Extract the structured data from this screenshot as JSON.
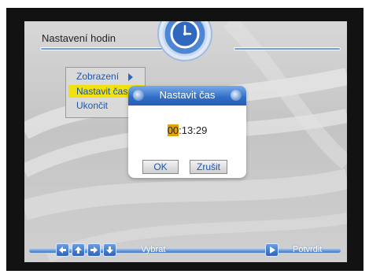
{
  "header": {
    "title": "Nastavení hodin"
  },
  "menu": {
    "items": [
      {
        "label": "Zobrazení",
        "has_submenu": true,
        "selected": false
      },
      {
        "label": "Nastavit čas",
        "has_submenu": false,
        "selected": true
      },
      {
        "label": "Ukončit",
        "has_submenu": false,
        "selected": false
      }
    ]
  },
  "dialog": {
    "title": "Nastavit čas",
    "time_hours": "00",
    "time_rest": ":13:29",
    "ok_label": "OK",
    "cancel_label": "Zrušit"
  },
  "footer": {
    "nav_keys": [
      "left-arrow-icon",
      "up-arrow-icon",
      "right-arrow-icon",
      "down-arrow-icon"
    ],
    "select_label": "Vybrat",
    "confirm_icon": "play-icon",
    "confirm_label": "Potvrdit"
  },
  "colors": {
    "accent_blue": "#2f6dc5",
    "highlight_yellow": "#f0e210",
    "time_highlight": "#e0a400"
  }
}
